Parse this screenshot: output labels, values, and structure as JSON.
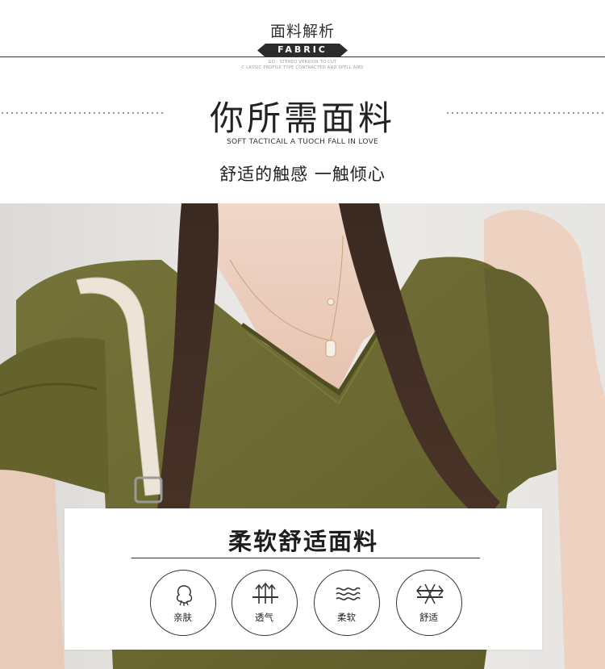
{
  "header": {
    "title": "面料解析",
    "badge": "FABRIC",
    "micro_line_1": "GO · STEREO VERSION TO CUT",
    "micro_line_2": "C LASSIC PROFILE TYPE CONTRACTED AND SPELL AIRS"
  },
  "headline": {
    "title": "你所需面料",
    "subtitle_en": "SOFT TACTICAIL A TUOCH FALL IN LOVE",
    "subtitle_cn": "舒适的触感 一触倾心"
  },
  "card": {
    "title": "柔软舒适面料",
    "features": [
      {
        "icon": "cotton-boll-icon",
        "label": "亲肤"
      },
      {
        "icon": "breathable-arrows-icon",
        "label": "透气"
      },
      {
        "icon": "soft-waves-icon",
        "label": "柔软"
      },
      {
        "icon": "stretch-arrows-icon",
        "label": "舒适"
      }
    ]
  },
  "colors": {
    "badge_bg": "#2b2b2b",
    "text": "#222222",
    "shirt_olive": "#6b6a2f",
    "background_wall": "#eae9e6"
  }
}
